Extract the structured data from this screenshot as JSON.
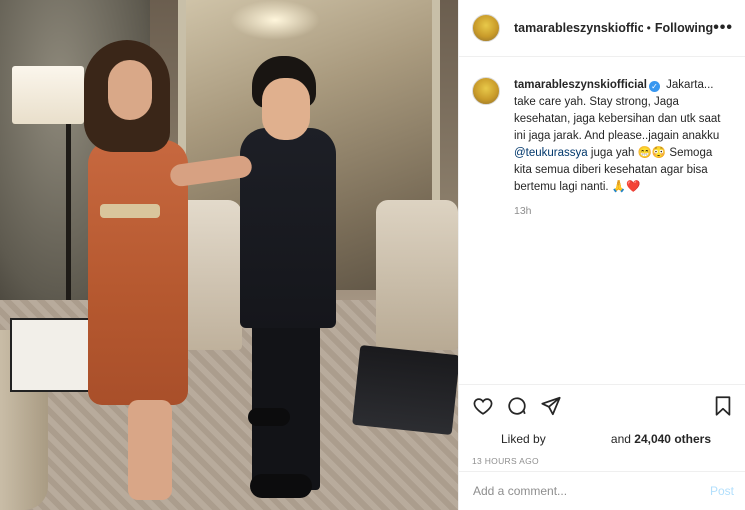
{
  "post": {
    "username": "tamarableszynskiofficial",
    "follow_status": "Following",
    "more_label": "•••",
    "caption_parts": [
      "Jakarta... take care yah. Stay strong, Jaga kesehatan, jaga kebersihan dan utk saat ini jaga jarak. And please..jagain anakku ",
      "@teukurassya",
      " juga yah ",
      "😁😳",
      " Semoga kita semua diberi kesehatan agar bisa bertemu lagi nanti. ",
      "🙏❤️"
    ],
    "caption_time": "13h",
    "liked_by_label": "Liked by",
    "likes_prefix": "and",
    "likes_count": "24,040 others",
    "post_time": "13 HOURS AGO",
    "comment_placeholder": "Add a comment...",
    "post_label": "Post"
  },
  "icons": {
    "like": "heart-icon",
    "comment": "comment-icon",
    "share": "paper-plane-icon",
    "save": "bookmark-icon",
    "verified": "verified-badge-icon"
  },
  "colors": {
    "verified_badge": "#3897f0",
    "mention": "#00376b",
    "post_button_disabled": "#b2dffc",
    "muted_text": "#8e8e8e"
  }
}
